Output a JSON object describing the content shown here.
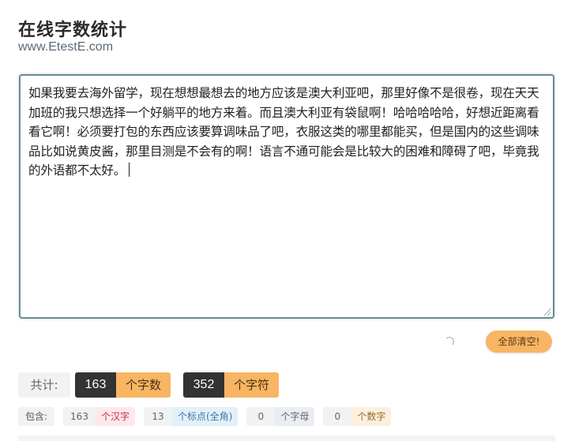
{
  "header": {
    "title": "在线字数统计",
    "site": "www.EtestE.com"
  },
  "editor": {
    "text": "如果我要去海外留学，现在想想最想去的地方应该是澳大利亚吧，那里好像不是很卷，现在天天加班的我只想选择一个好躺平的地方来着。而且澳大利亚有袋鼠啊！哈哈哈哈哈，好想近距离看看它啊！必须要打包的东西应该要算调味品了吧，衣服这类的哪里都能买，但是国内的这些调味品比如说黄皮酱，那里目测是不会有的啊！语言不通可能会是比较大的困难和障碍了吧，毕竟我的外语都不太好。"
  },
  "actions": {
    "clear_label": "全部清空!"
  },
  "summary": {
    "label": "共计:",
    "word_count": "163",
    "word_unit": "个字数",
    "char_count": "352",
    "char_unit": "个字符"
  },
  "details": {
    "label": "包含:",
    "han_count": "163",
    "han_label": "个汉字",
    "punct_count": "13",
    "punct_label": "个标点(全角)",
    "letter_count": "0",
    "letter_label": "个字母",
    "digit_count": "0",
    "digit_label": "个数字"
  },
  "colors": {
    "accent": "#f8b564",
    "dark": "#333333",
    "editor_border": "#6a8a96"
  }
}
